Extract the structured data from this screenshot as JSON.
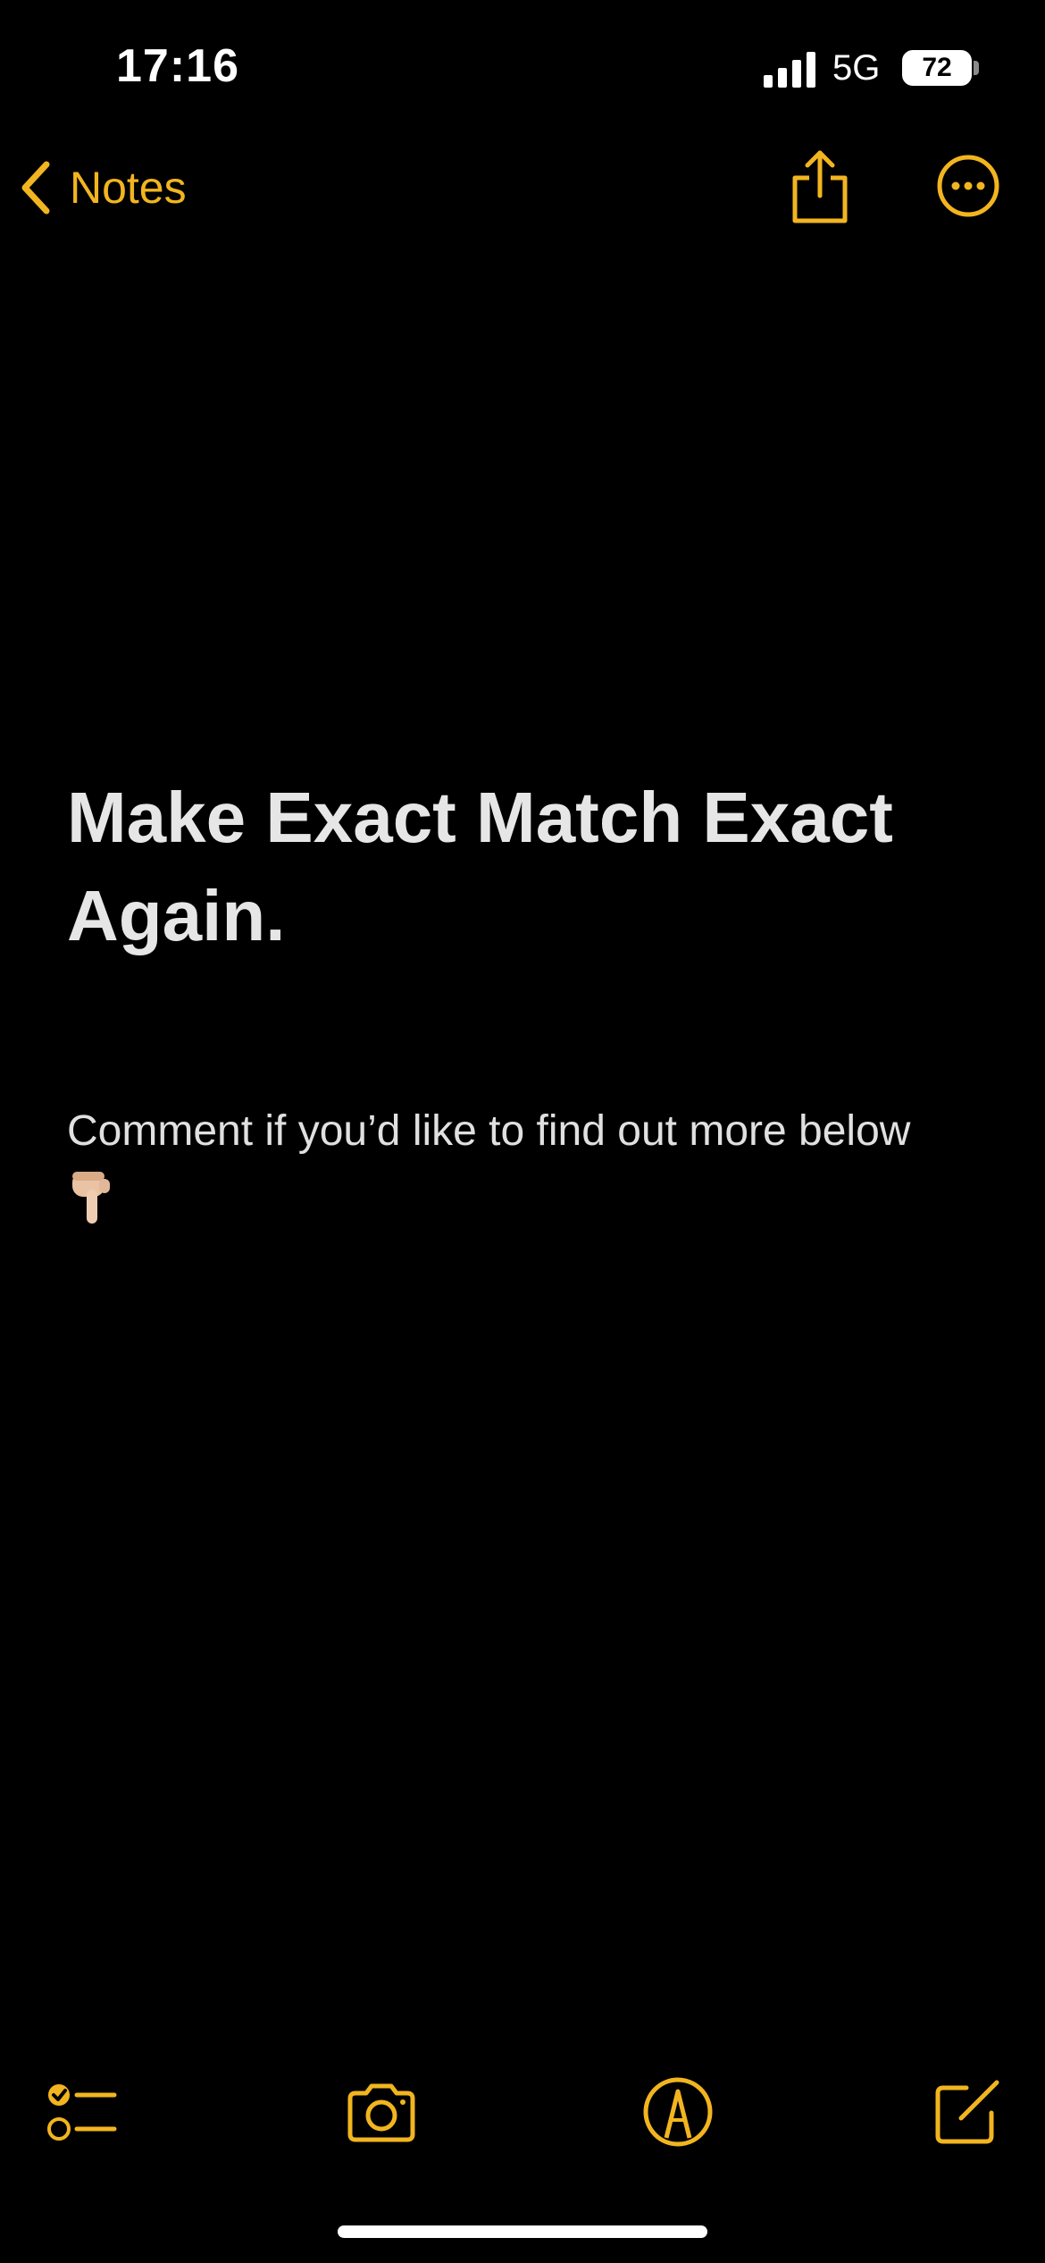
{
  "status_bar": {
    "time": "17:16",
    "network": "5G",
    "battery": "72",
    "icons": [
      "signal-icon",
      "battery-icon"
    ]
  },
  "nav": {
    "back_label": "Notes",
    "icons": [
      "chevron-left-icon",
      "share-icon",
      "more-icon"
    ]
  },
  "note": {
    "title": "Make Exact Match Exact Again.",
    "body": "Comment if you’d like to find out more below"
  },
  "toolbar": {
    "icons": [
      "checklist-icon",
      "camera-icon",
      "markup-icon",
      "compose-icon"
    ]
  },
  "colors": {
    "accent": "#f2b51f",
    "background": "#000000",
    "text": "#e6e6e6"
  }
}
